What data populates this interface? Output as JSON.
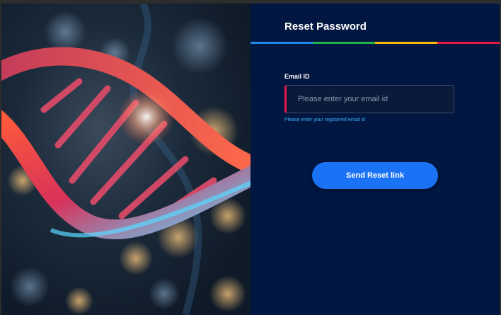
{
  "page": {
    "title": "Reset Password"
  },
  "form": {
    "email_label": "Email ID",
    "email_value": "",
    "email_placeholder": "Please enter your email id",
    "hint": "Please enter your registered email id",
    "submit_label": "Send Reset link"
  },
  "theme": {
    "panel_bg": "#011640",
    "accent_blue": "#1a73f5",
    "error_red": "#e8194a",
    "hint_blue": "#39b6ff",
    "rainbow": [
      "#1e88e5",
      "#20b24a",
      "#f7b900",
      "#e8194a"
    ]
  },
  "decor": {
    "side_image": "dna-helix-illustration"
  }
}
